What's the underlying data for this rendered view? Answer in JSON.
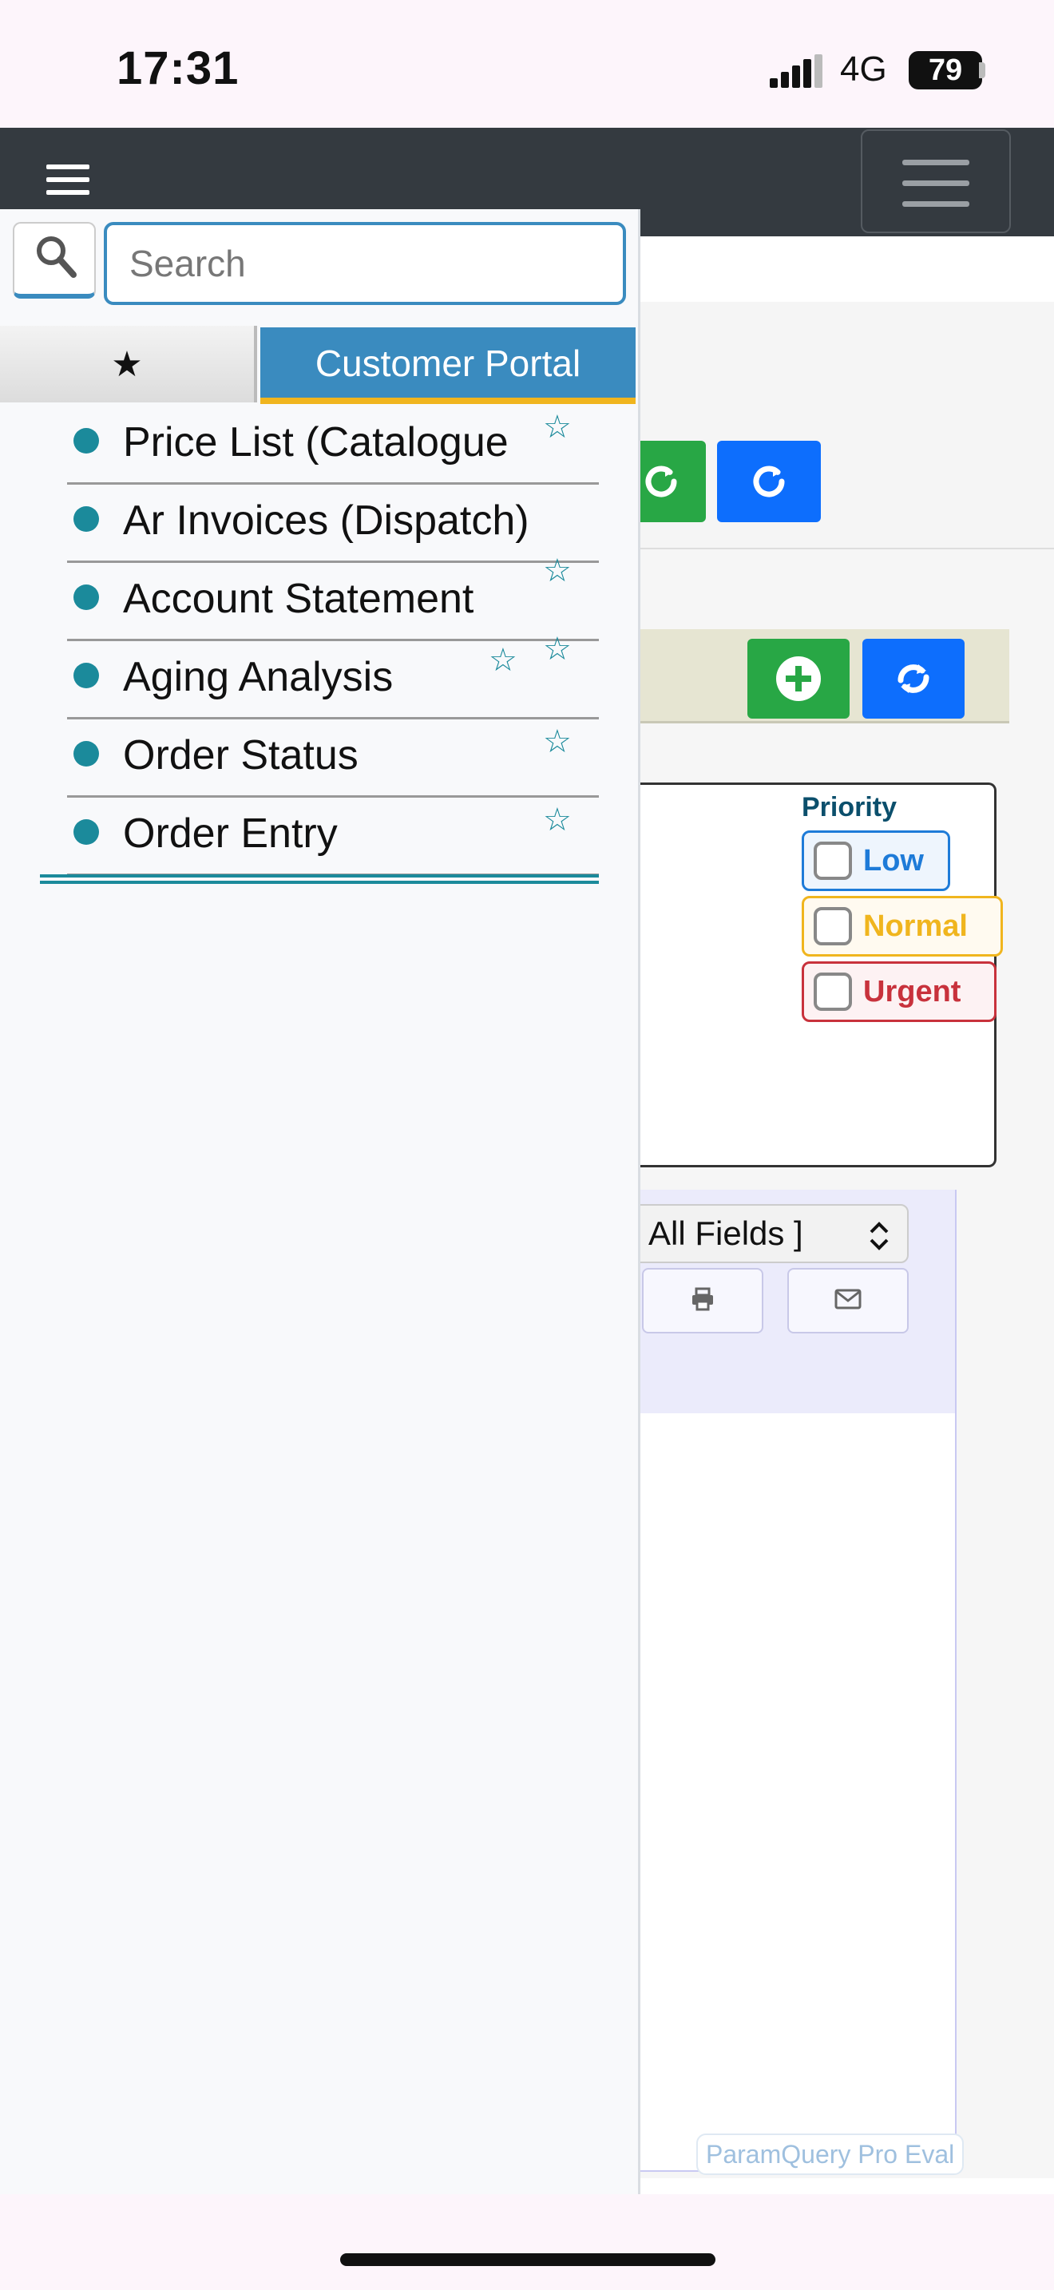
{
  "status_bar": {
    "time": "17:31",
    "network": "4G",
    "battery": "79"
  },
  "search": {
    "placeholder": "Search"
  },
  "tabs": {
    "favorites_icon": "star-filled-icon",
    "portal_label": "Customer Portal"
  },
  "menu": {
    "items": [
      {
        "label": "Price List (Catalogue"
      },
      {
        "label": "Ar Invoices (Dispatch)"
      },
      {
        "label": "Account Statement"
      },
      {
        "label": "Aging Analysis"
      },
      {
        "label": "Order Status"
      },
      {
        "label": "Order Entry"
      }
    ]
  },
  "priority": {
    "label": "Priority",
    "options": [
      {
        "label": "Low",
        "color": "#1e7bd8"
      },
      {
        "label": "Normal",
        "color": "#f0b51e"
      },
      {
        "label": "Urgent",
        "color": "#c8323c"
      }
    ]
  },
  "grid": {
    "fields_select": "All Fields ]"
  },
  "watermark": "ParamQuery Pro Eval",
  "colors": {
    "accent": "#3a8bbf",
    "teal": "#1b8a9b",
    "navbar": "#343a40",
    "green": "#28a745",
    "blue": "#0d6efd"
  }
}
